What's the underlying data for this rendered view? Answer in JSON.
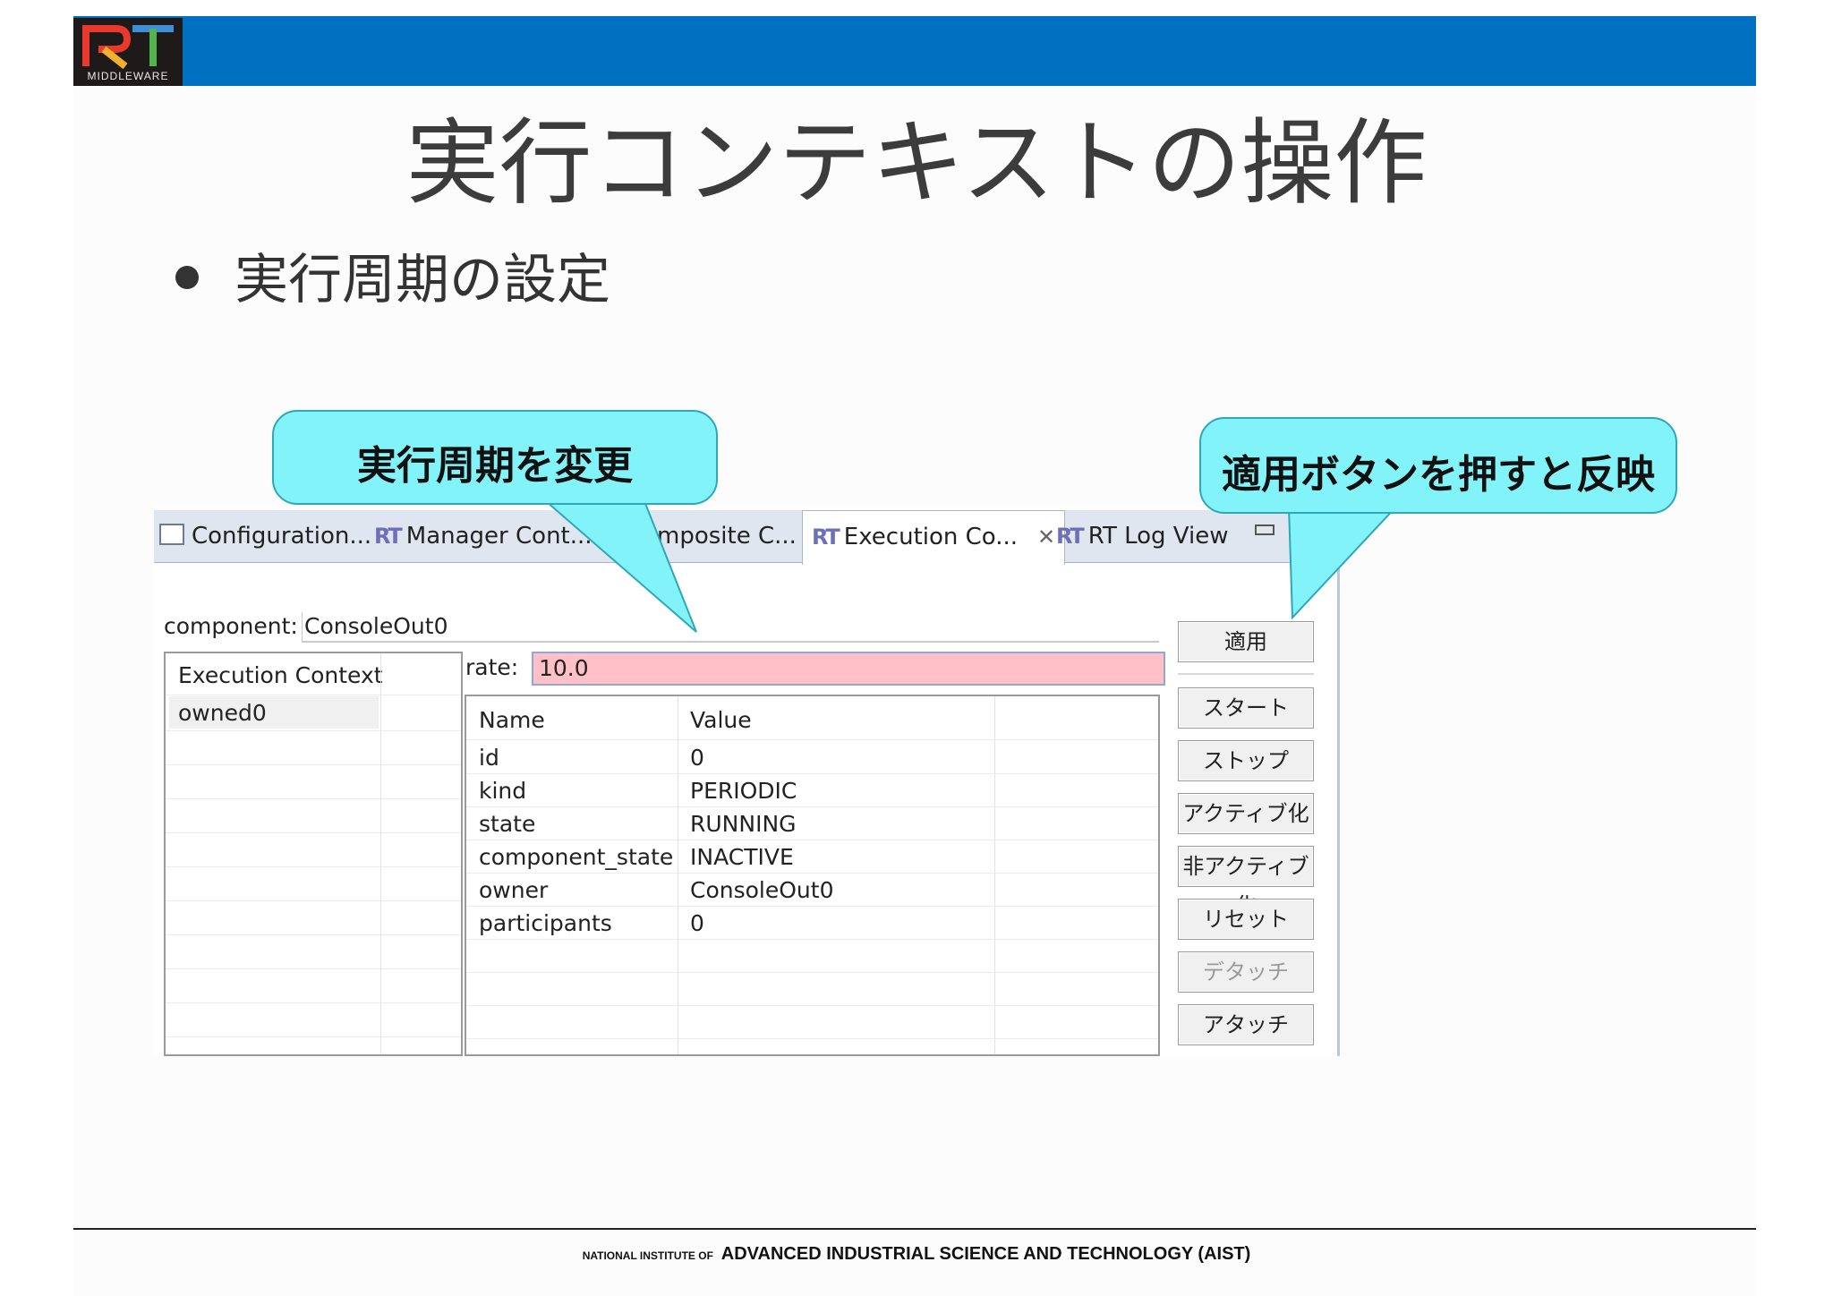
{
  "logo": {
    "letters": "RT",
    "text": "MIDDLEWARE"
  },
  "slide": {
    "title": "実行コンテキストの操作",
    "bullet": "実行周期の設定"
  },
  "callouts": {
    "left": "実行周期を変更",
    "right": "適用ボタンを押すと反映"
  },
  "tabs": [
    {
      "label": "Configuration...",
      "icon": "window-icon"
    },
    {
      "label": "Manager Cont...",
      "icon": "RT"
    },
    {
      "label": "mposite C...",
      "icon": ""
    },
    {
      "label": "Execution Co...",
      "icon": "RT",
      "active": true,
      "close": "✕"
    },
    {
      "label": "RT Log View",
      "icon": "RT"
    }
  ],
  "form": {
    "component_label": "component:",
    "component_value": "ConsoleOut0",
    "rate_label": "rate:",
    "rate_value": "10.0"
  },
  "ec_list": {
    "header": "Execution Context",
    "items": [
      "owned0"
    ]
  },
  "props": {
    "headers": [
      "Name",
      "Value"
    ],
    "rows": [
      [
        "id",
        "0"
      ],
      [
        "kind",
        "PERIODIC"
      ],
      [
        "state",
        "RUNNING"
      ],
      [
        "component_state",
        "INACTIVE"
      ],
      [
        "owner",
        "ConsoleOut0"
      ],
      [
        "participants",
        "0"
      ]
    ]
  },
  "buttons": {
    "apply": "適用",
    "start": "スタート",
    "stop": "ストップ",
    "activate": "アクティブ化",
    "deactivate": "非アクティブ化",
    "reset": "リセット",
    "detach": "デタッチ",
    "attach": "アタッチ"
  },
  "footer": {
    "prefix": "NATIONAL INSTITUTE OF",
    "main": "ADVANCED INDUSTRIAL SCIENCE AND TECHNOLOGY (AIST)"
  },
  "colors": {
    "topbar": "#0070c0",
    "callout": "#82f3f8",
    "rate_invalid_bg": "#ffc0c8"
  }
}
